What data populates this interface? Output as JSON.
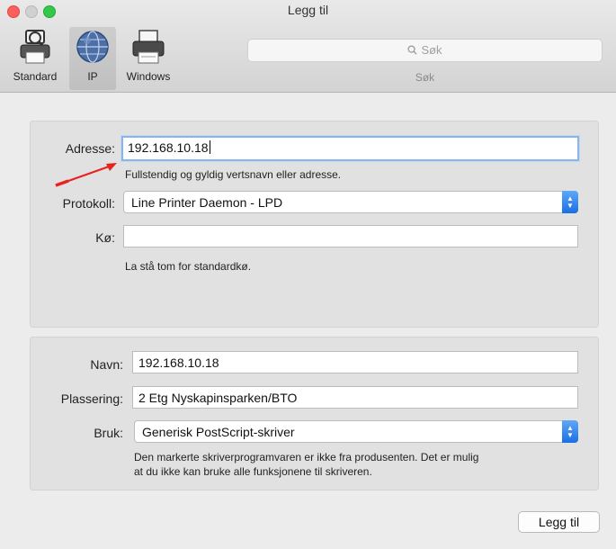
{
  "window": {
    "title": "Legg til"
  },
  "toolbar": {
    "items": [
      {
        "label": "Standard",
        "icon": "standard-printer-icon"
      },
      {
        "label": "IP",
        "icon": "globe-icon"
      },
      {
        "label": "Windows",
        "icon": "windows-printer-icon"
      }
    ],
    "search": {
      "placeholder": "Søk",
      "caption": "Søk"
    }
  },
  "connection": {
    "address_label": "Adresse:",
    "address_value": "192.168.10.18",
    "address_hint": "Fullstendig og gyldig vertsnavn eller adresse.",
    "protocol_label": "Protokoll:",
    "protocol_value": "Line Printer Daemon - LPD",
    "queue_label": "Kø:",
    "queue_value": "",
    "queue_hint": "La stå tom for standardkø."
  },
  "printer": {
    "name_label": "Navn:",
    "name_value": "192.168.10.18",
    "location_label": "Plassering:",
    "location_value": "2 Etg Nyskapinsparken/BTO",
    "use_label": "Bruk:",
    "use_value": "Generisk PostScript-skriver",
    "warning_line1": "Den markerte skriverprogramvaren er ikke fra produsenten. Det er mulig",
    "warning_line2": "at du ikke kan bruke alle funksjonene til skriveren."
  },
  "actions": {
    "add_label": "Legg til"
  },
  "colors": {
    "annotation_arrow": "#e8231d",
    "accent": "#1b6fe5",
    "focus_ring": "#8db4ea"
  }
}
